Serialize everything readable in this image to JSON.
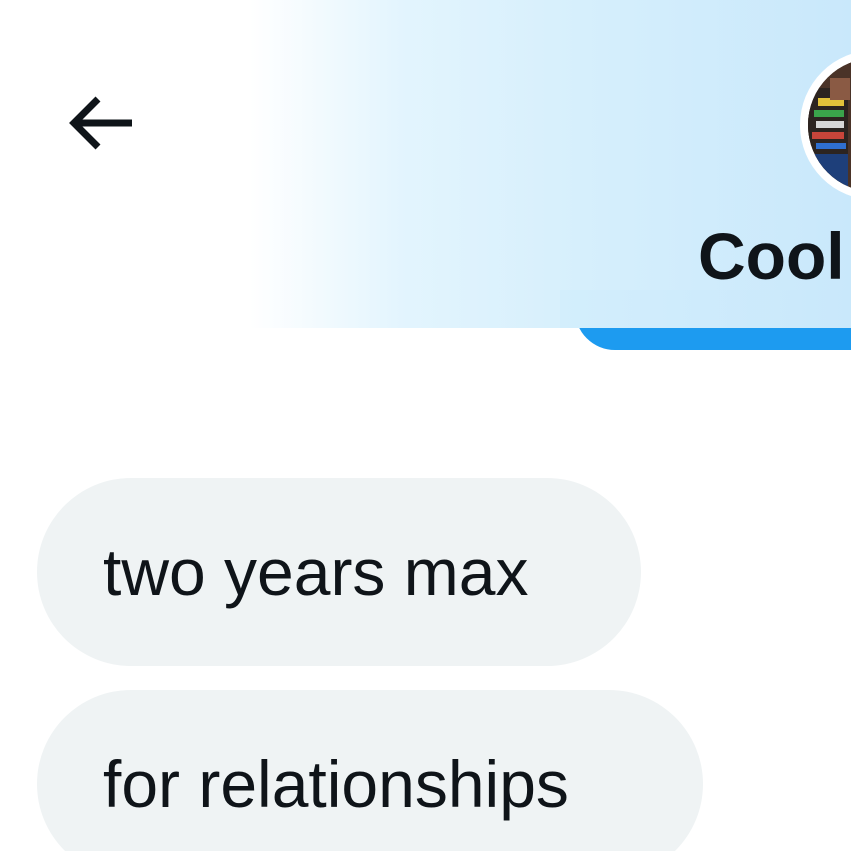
{
  "header": {
    "back_icon": "arrow-left-icon",
    "display_name": "Cool",
    "avatar_icon": "profile-photo",
    "banner_color": "#c9e8fb",
    "accent_color": "#1d9bf0"
  },
  "messages": [
    {
      "text": "two years max"
    },
    {
      "text": "for relationships"
    }
  ],
  "colors": {
    "bubble_background": "#eff3f4",
    "text": "#0f1419"
  }
}
